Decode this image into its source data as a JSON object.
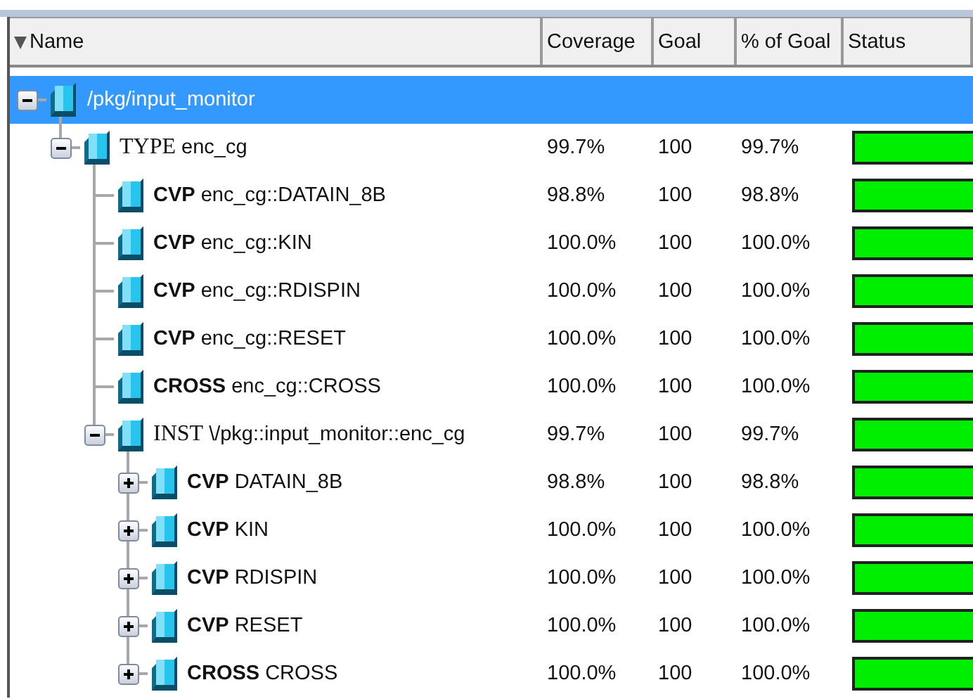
{
  "columns": [
    "Name",
    "Coverage",
    "Goal",
    "% of Goal",
    "Status"
  ],
  "tree": [
    {
      "name": "/pkg/input_monitor",
      "selected": true,
      "expanded": true,
      "children": [
        {
          "kind": "scope",
          "tag": "TYPE",
          "name": "enc_cg",
          "coverage": "99.7%",
          "goal": "100",
          "percent_of_goal": "99.7%",
          "level": 0.997,
          "selected": false,
          "expanded": true,
          "children": [
            {
              "kind": "point",
              "tag": "CVP",
              "name": "enc_cg::DATAIN_8B",
              "coverage": "98.8%",
              "goal": "100",
              "percent_of_goal": "98.8%",
              "level": 0.988,
              "selected": false
            },
            {
              "kind": "point",
              "tag": "CVP",
              "name": "enc_cg::KIN",
              "coverage": "100.0%",
              "goal": "100",
              "percent_of_goal": "100.0%",
              "level": 1,
              "selected": false
            },
            {
              "kind": "point",
              "tag": "CVP",
              "name": "enc_cg::RDISPIN",
              "coverage": "100.0%",
              "goal": "100",
              "percent_of_goal": "100.0%",
              "level": 1,
              "selected": false
            },
            {
              "kind": "point",
              "tag": "CVP",
              "name": "enc_cg::RESET",
              "coverage": "100.0%",
              "goal": "100",
              "percent_of_goal": "100.0%",
              "level": 1,
              "selected": false
            },
            {
              "kind": "point",
              "tag": "CROSS",
              "name": "enc_cg::CROSS",
              "coverage": "100.0%",
              "goal": "100",
              "percent_of_goal": "100.0%",
              "level": 1,
              "selected": false
            },
            {
              "kind": "scope",
              "tag": "INST",
              "name": "\\/pkg::input_monitor::enc_cg",
              "coverage": "99.7%",
              "goal": "100",
              "percent_of_goal": "99.7%",
              "level": 0.997,
              "selected": false,
              "expanded": true,
              "children": [
                {
                  "kind": "point",
                  "tag": "CVP",
                  "name": "DATAIN_8B",
                  "coverage": "98.8%",
                  "goal": "100",
                  "percent_of_goal": "98.8%",
                  "level": 0.988,
                  "selected": false,
                  "expanded": false
                },
                {
                  "kind": "point",
                  "tag": "CVP",
                  "name": "KIN",
                  "coverage": "100.0%",
                  "goal": "100",
                  "percent_of_goal": "100.0%",
                  "level": 1,
                  "selected": false,
                  "expanded": false
                },
                {
                  "kind": "point",
                  "tag": "CVP",
                  "name": "RDISPIN",
                  "coverage": "100.0%",
                  "goal": "100",
                  "percent_of_goal": "100.0%",
                  "level": 1,
                  "selected": false,
                  "expanded": false
                },
                {
                  "kind": "point",
                  "tag": "CVP",
                  "name": "RESET",
                  "coverage": "100.0%",
                  "goal": "100",
                  "percent_of_goal": "100.0%",
                  "level": 1,
                  "selected": false,
                  "expanded": false
                },
                {
                  "kind": "point",
                  "tag": "CROSS",
                  "name": "CROSS",
                  "coverage": "100.0%",
                  "goal": "100",
                  "percent_of_goal": "100.0%",
                  "level": 1,
                  "selected": false,
                  "expanded": false
                }
              ]
            }
          ]
        }
      ]
    }
  ]
}
